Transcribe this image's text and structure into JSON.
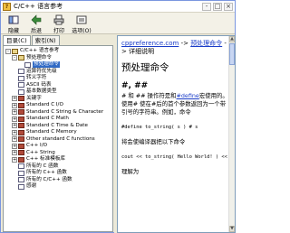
{
  "window": {
    "title": "C/C++ 语言参考",
    "icon_glyph": "?",
    "controls": [
      "-",
      "□",
      "×"
    ]
  },
  "toolbar": {
    "buttons": [
      {
        "label": "隐藏",
        "icon": "hide-icon"
      },
      {
        "label": "后退",
        "icon": "back-arrow-icon"
      },
      {
        "label": "打印",
        "icon": "print-icon"
      },
      {
        "label": "选项(O)",
        "icon": "options-icon"
      }
    ]
  },
  "tabs": {
    "contents": "目录(C)",
    "index": "索引(N)"
  },
  "tree": {
    "items": [
      {
        "label": "C/C++ 语言参考",
        "level": 0,
        "exp": "-",
        "icon": "openbook"
      },
      {
        "label": "预处理命令",
        "level": 1,
        "exp": "-",
        "icon": "openbook"
      },
      {
        "label": "预处理命令",
        "level": 2,
        "exp": "",
        "icon": "page",
        "selected": true
      },
      {
        "label": "运算符优先级",
        "level": 1,
        "exp": "",
        "icon": "page"
      },
      {
        "label": "转义字符",
        "level": 1,
        "exp": "",
        "icon": "page"
      },
      {
        "label": "ASCII 码表",
        "level": 1,
        "exp": "",
        "icon": "page"
      },
      {
        "label": "基本数据类型",
        "level": 1,
        "exp": "",
        "icon": "page"
      },
      {
        "label": "关键字",
        "level": 1,
        "exp": "+",
        "icon": "book"
      },
      {
        "label": "Standard C I/O",
        "level": 1,
        "exp": "+",
        "icon": "book"
      },
      {
        "label": "Standard C String & Character",
        "level": 1,
        "exp": "+",
        "icon": "book"
      },
      {
        "label": "Standard C Math",
        "level": 1,
        "exp": "+",
        "icon": "book"
      },
      {
        "label": "Standard C Time & Date",
        "level": 1,
        "exp": "+",
        "icon": "book"
      },
      {
        "label": "Standard C Memory",
        "level": 1,
        "exp": "+",
        "icon": "book"
      },
      {
        "label": "Other standard C functions",
        "level": 1,
        "exp": "+",
        "icon": "book"
      },
      {
        "label": "C++ I/O",
        "level": 1,
        "exp": "+",
        "icon": "book"
      },
      {
        "label": "C++ String",
        "level": 1,
        "exp": "+",
        "icon": "book"
      },
      {
        "label": "C++ 标准模板库",
        "level": 1,
        "exp": "+",
        "icon": "book"
      },
      {
        "label": "所有的 C 函数",
        "level": 1,
        "exp": "",
        "icon": "page"
      },
      {
        "label": "所有的 C++ 函数",
        "level": 1,
        "exp": "",
        "icon": "page"
      },
      {
        "label": "所有的 C/C++ 函数",
        "level": 1,
        "exp": "",
        "icon": "page"
      },
      {
        "label": "感谢",
        "level": 1,
        "exp": "",
        "icon": "page"
      }
    ]
  },
  "content": {
    "breadcrumb_site": "cppreference.com",
    "breadcrumb_sep1": " -> ",
    "breadcrumb_cmd": "预处理命令",
    "breadcrumb_sep2": " -> ",
    "breadcrumb_detail": "详细说明",
    "heading": "预处理命令",
    "subheading": "#, ##",
    "para1_a": "# 和 ## 操作符是和",
    "para1_link": "#define",
    "para1_b": "宏使用的。使用# 使在#后的首个参数返回为一个带引号的字符串。例如，命令",
    "code1": "#define to_string( s ) # s",
    "para2": "将会使编译器把以下命令",
    "code2": "cout << to_string( Hello World! ) << endl;",
    "para3": "理解为"
  }
}
